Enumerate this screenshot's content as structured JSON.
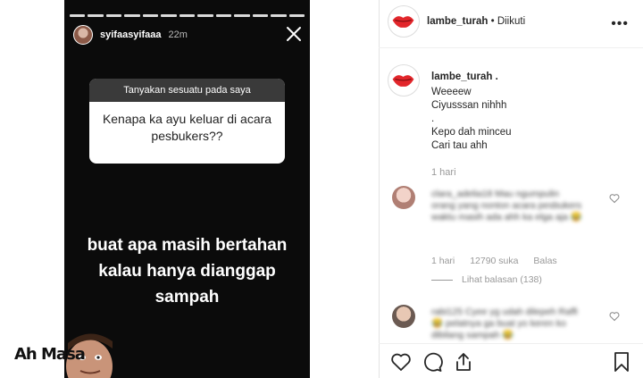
{
  "story": {
    "username": "syifaasyifaaa",
    "time": "22m",
    "question_prompt": "Tanyakan sesuatu pada saya",
    "question_text_1": "Kenapa ka ayu keluar di acara",
    "question_text_2": "pesbukers??",
    "body_line_1": "buat apa masih bertahan",
    "body_line_2": "kalau hanya dianggap",
    "body_line_3": "sampah",
    "meme_caption": "Ah Masa"
  },
  "post": {
    "username": "lambe_turah",
    "follow_status": "• Diikuti",
    "caption_user": "lambe_turah .",
    "caption_lines": "Weeeew\nCiyusssan nihhh\n.\nKepo dah minceu\nCari tau ahh",
    "caption_time": "1 hari",
    "comment1": {
      "text": "clara_adelia18 Mau ngumpulin orang yang nonton acara pesbukers waktu masih ada ahh ka elga aja 😂",
      "time": "1 hari",
      "likes": "12790 suka",
      "reply": "Balas",
      "view_replies": "Lihat balasan (138)"
    },
    "comment2": {
      "text": "rabi125 Cyee yg udah dilepeh Raffi 😂 pelatnya ga buat yo keren ko dibilang sampah 😂"
    }
  },
  "colors": {
    "accent": "#ed4956",
    "text": "#262626",
    "muted": "#999999"
  }
}
